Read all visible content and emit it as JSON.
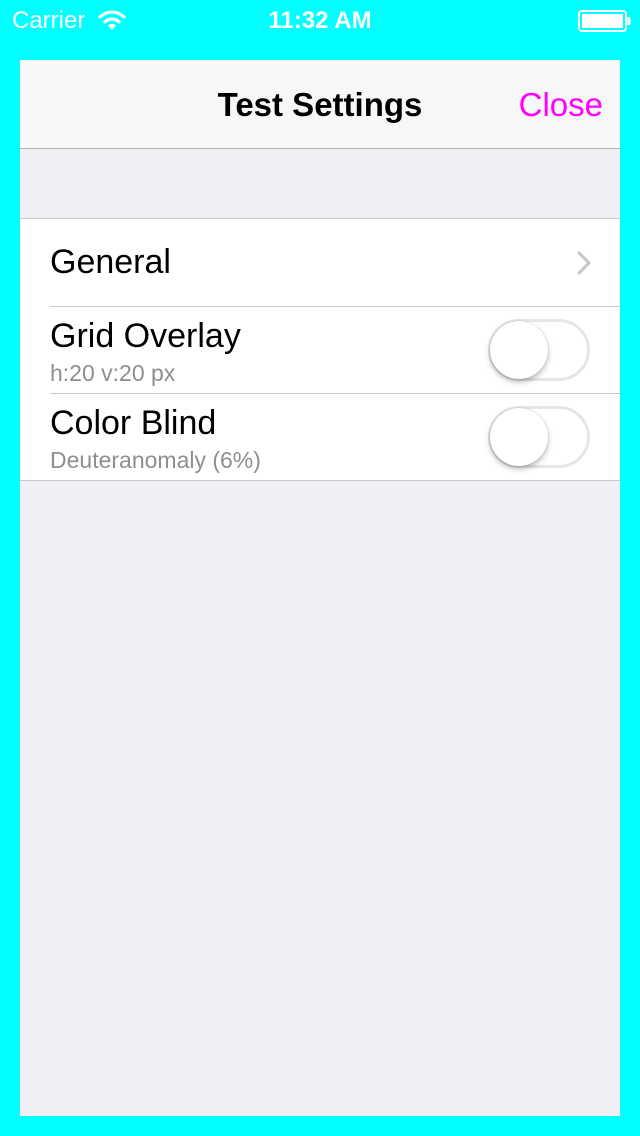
{
  "status_bar": {
    "carrier": "Carrier",
    "time": "11:32 AM",
    "wifi_icon": "wifi-icon",
    "battery_icon": "battery-icon"
  },
  "nav": {
    "title": "Test Settings",
    "close_label": "Close",
    "close_color": "#FF00FF"
  },
  "settings": {
    "general": {
      "label": "General",
      "accessory_icon": "chevron-right-icon"
    },
    "grid_overlay": {
      "title": "Grid Overlay",
      "subtitle": "h:20 v:20 px",
      "enabled": false
    },
    "color_blind": {
      "title": "Color Blind",
      "subtitle": "Deuteranomaly (6%)",
      "enabled": false
    }
  },
  "colors": {
    "background": "#00FFFF",
    "sheet": "#EFEFF4",
    "accent": "#FF00FF"
  }
}
